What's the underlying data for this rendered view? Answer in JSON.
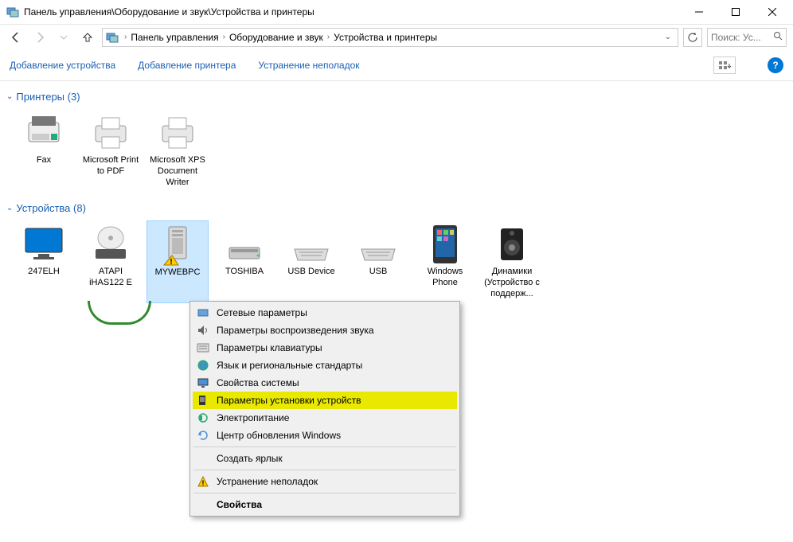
{
  "titlebar": {
    "title": "Панель управления\\Оборудование и звук\\Устройства и принтеры"
  },
  "breadcrumb": {
    "items": [
      "Панель управления",
      "Оборудование и звук",
      "Устройства и принтеры"
    ]
  },
  "search": {
    "placeholder": "Поиск: Ус..."
  },
  "toolbar": {
    "add_device": "Добавление устройства",
    "add_printer": "Добавление принтера",
    "troubleshoot": "Устранение неполадок"
  },
  "groups": {
    "printers": {
      "title": "Принтеры (3)"
    },
    "devices": {
      "title": "Устройства (8)"
    }
  },
  "printers": [
    {
      "label": "Fax"
    },
    {
      "label": "Microsoft Print to PDF"
    },
    {
      "label": "Microsoft XPS Document Writer"
    }
  ],
  "devices": [
    {
      "label": "247ELH"
    },
    {
      "label": "ATAPI iHAS122   E"
    },
    {
      "label": "MYWEBPC"
    },
    {
      "label": "TOSHIBA"
    },
    {
      "label": "USB Device"
    },
    {
      "label": "USB"
    },
    {
      "label": "Windows Phone"
    },
    {
      "label": "Динамики (Устройство с поддерж..."
    }
  ],
  "context_menu": {
    "items": [
      "Сетевые параметры",
      "Параметры воспроизведения звука",
      "Параметры клавиатуры",
      "Язык и региональные стандарты",
      "Свойства системы",
      "Параметры установки устройств",
      "Электропитание",
      "Центр обновления Windows",
      "Создать ярлык",
      "Устранение неполадок",
      "Свойства"
    ]
  }
}
